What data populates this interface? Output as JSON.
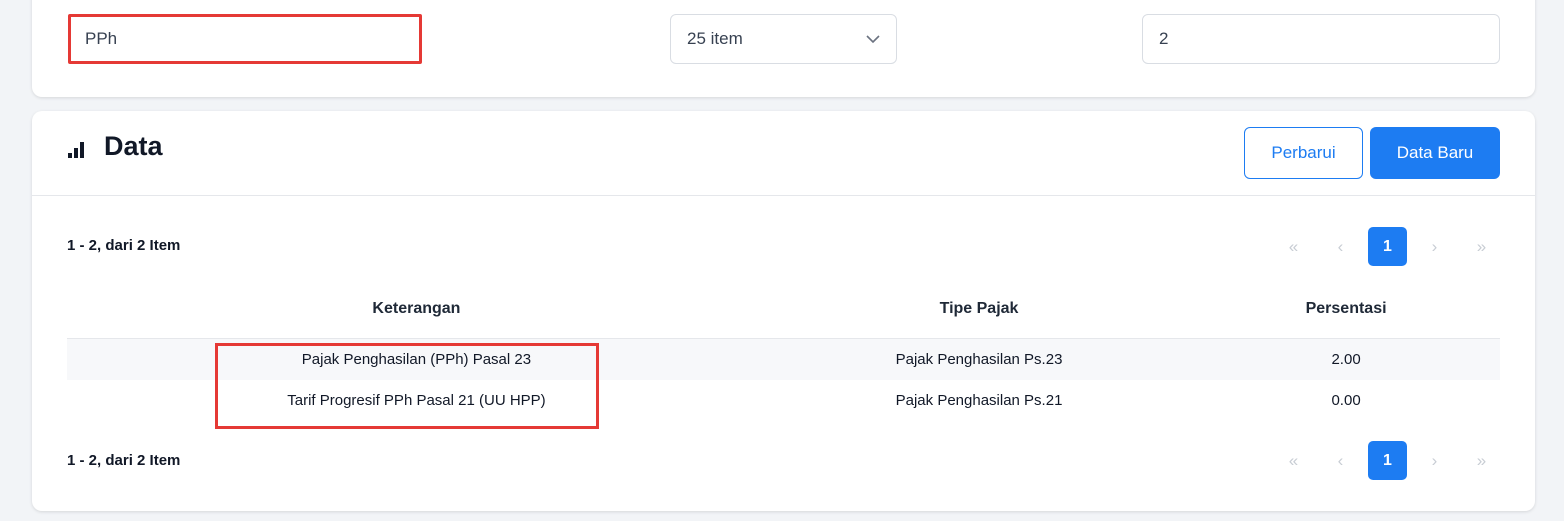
{
  "filters": {
    "search_value": "PPh",
    "page_size": "25 item",
    "page_number": "2"
  },
  "data_section": {
    "title": "Data",
    "refresh_button": "Perbarui",
    "new_button": "Data Baru",
    "summary_top": "1 - 2, dari 2 Item",
    "summary_bottom": "1 - 2, dari 2 Item"
  },
  "pagination": {
    "first": "«",
    "prev": "‹",
    "current": "1",
    "next": "›",
    "last": "»"
  },
  "table": {
    "headers": [
      "Keterangan",
      "Tipe Pajak",
      "Persentasi"
    ],
    "rows": [
      [
        "Pajak Penghasilan (PPh) Pasal 23",
        "Pajak Penghasilan Ps.23",
        "2.00"
      ],
      [
        "Tarif Progresif PPh Pasal 21 (UU HPP)",
        "Pajak Penghasilan Ps.21",
        "0.00"
      ]
    ]
  },
  "colors": {
    "accent": "#1d7cf2",
    "highlight": "#e53935"
  },
  "icons": {
    "chart": "bar-chart-icon",
    "dropdown": "chevron-down-icon"
  }
}
